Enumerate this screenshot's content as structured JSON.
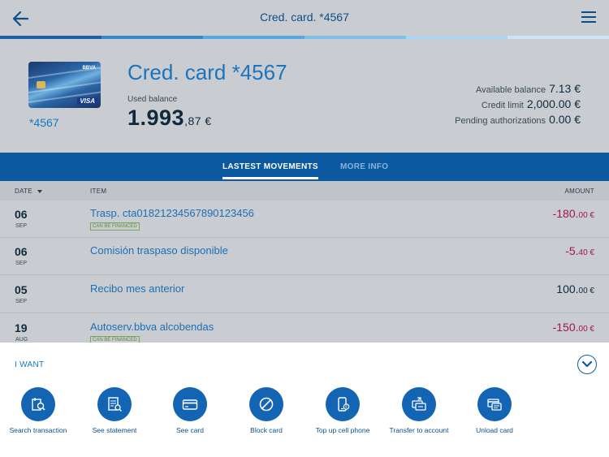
{
  "header": {
    "title": "Cred. card. *4567"
  },
  "progress_colors": [
    "#1f5fa8",
    "#3b86c8",
    "#5aa7dd",
    "#7fc0ea",
    "#a9d6f2",
    "#c9e5f6"
  ],
  "card": {
    "brand": "BBVA",
    "network": "VISA",
    "last_digits": "*4567",
    "name": "Cred. card *4567",
    "used_balance_label": "Used balance",
    "used_balance_int": "1.993",
    "used_balance_dec": ",87 €"
  },
  "balances": [
    {
      "label": "Available balance",
      "value": "7.13 €"
    },
    {
      "label": "Credit limit",
      "value": "2,000.00 €"
    },
    {
      "label": "Pending authorizations",
      "value": "0.00 €"
    }
  ],
  "tabs": {
    "movements": "LASTEST MOVEMENTS",
    "info": "MORE INFO"
  },
  "table": {
    "col_date": "DATE",
    "col_item": "ITEM",
    "col_amount": "AMOUNT"
  },
  "movements": [
    {
      "day": "06",
      "month": "SEP",
      "item": "Trasp. cta01821234567890123456",
      "badge": "CAN BE FINANCED",
      "amount_int": "-180.",
      "amount_dec": "00 €",
      "negative": true
    },
    {
      "day": "06",
      "month": "SEP",
      "item": "Comisión traspaso disponible",
      "badge": "",
      "amount_int": "-5.",
      "amount_dec": "40 €",
      "negative": true
    },
    {
      "day": "05",
      "month": "SEP",
      "item": "Recibo mes anterior",
      "badge": "",
      "amount_int": "100.",
      "amount_dec": "00 €",
      "negative": false
    },
    {
      "day": "19",
      "month": "AUG",
      "item": "Autoserv.bbva alcobendas",
      "badge": "CAN BE FINANCED",
      "amount_int": "-150.",
      "amount_dec": "00 €",
      "negative": true
    }
  ],
  "panel": {
    "title": "I WANT",
    "actions": [
      {
        "label": "Search transaction",
        "icon": "search-transaction-icon"
      },
      {
        "label": "See statement",
        "icon": "statement-icon"
      },
      {
        "label": "See card",
        "icon": "card-icon"
      },
      {
        "label": "Block card",
        "icon": "block-icon"
      },
      {
        "label": "Top up cell phone",
        "icon": "phone-icon"
      },
      {
        "label": "Transfer to account",
        "icon": "transfer-icon"
      },
      {
        "label": "Unload card",
        "icon": "unload-card-icon"
      }
    ]
  }
}
